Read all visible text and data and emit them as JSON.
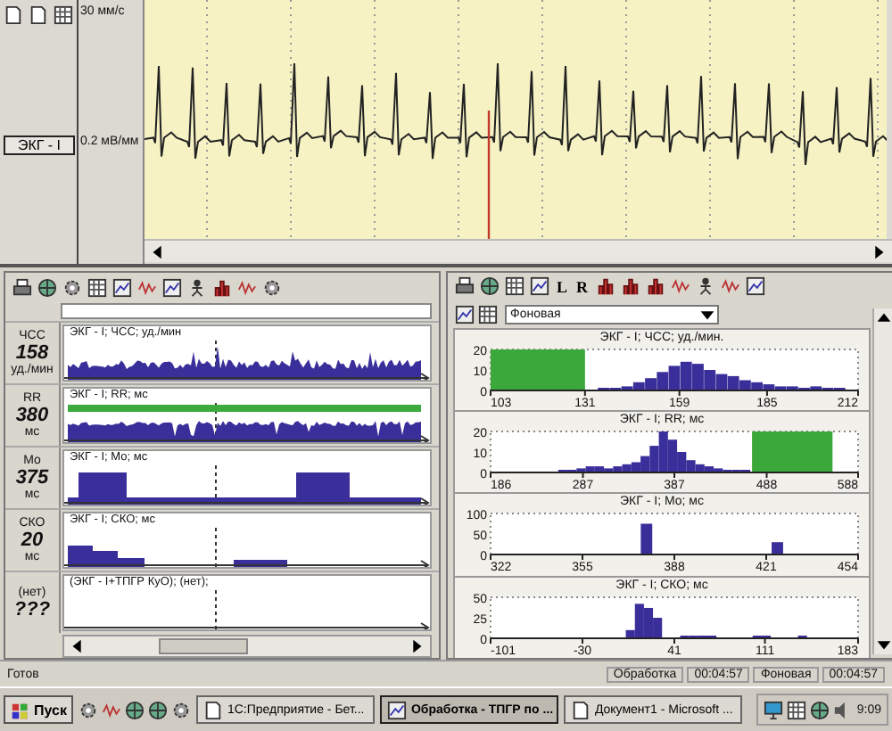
{
  "ecg": {
    "speed": "30 мм/с",
    "gain": "0.2 мВ/мм",
    "lead": "ЭКГ - I"
  },
  "trend_panel": {
    "rows": [
      {
        "name": "ЧСС",
        "value": "158",
        "unit": "уд./мин",
        "title": "ЭКГ - I; ЧСС; уд./мин",
        "kind": "dense"
      },
      {
        "name": "RR",
        "value": "380",
        "unit": "мс",
        "title": "ЭКГ - I; RR; мс",
        "kind": "dense-band"
      },
      {
        "name": "Мо",
        "value": "375",
        "unit": "мс",
        "title": "ЭКГ - I; Мо; мс",
        "kind": "blocks"
      },
      {
        "name": "СКО",
        "value": "20",
        "unit": "мс",
        "title": "ЭКГ - I; СКО; мс",
        "kind": "decay"
      },
      {
        "name": "(нет)",
        "value": "???",
        "title": "(ЭКГ - I+ТПГР КуО); (нет);",
        "kind": "empty"
      }
    ]
  },
  "histogram_panel": {
    "toolbar_letters": [
      "L",
      "R"
    ],
    "mode": "Фоновая",
    "charts": [
      {
        "chart_data": {
          "type": "bar",
          "title": "ЭКГ - I; ЧСС; уд./мин.",
          "x": [
            136.5,
            140,
            143.5,
            147,
            150.5,
            154,
            157.5,
            161,
            164.5,
            168,
            171.5,
            175,
            178.5,
            182,
            185.5,
            189,
            192.5,
            196,
            199.5,
            203,
            206.5
          ],
          "series": [
            {
              "color": "#3a2f9a",
              "values": [
                1,
                1,
                2,
                4,
                6,
                9,
                12,
                14,
                13,
                10,
                8,
                7,
                5,
                4,
                3,
                2,
                2,
                1,
                2,
                1,
                1
              ]
            }
          ],
          "xlim": [
            103,
            212
          ],
          "ylim": [
            0,
            20
          ],
          "xticks": [
            103,
            131,
            159,
            185,
            212
          ],
          "yticks": [
            0,
            10,
            20
          ],
          "bands": [
            {
              "axis": "x",
              "from": 103,
              "to": 131,
              "color": "#3aa83a"
            }
          ]
        }
      },
      {
        "chart_data": {
          "type": "bar",
          "title": "ЭКГ - I; RR; мс",
          "x": [
            265,
            275,
            285,
            295,
            305,
            315,
            325,
            335,
            345,
            355,
            365,
            375,
            385,
            395,
            405,
            415,
            425,
            435,
            445,
            455,
            465
          ],
          "series": [
            {
              "color": "#3a2f9a",
              "values": [
                1,
                1,
                2,
                3,
                3,
                2,
                3,
                4,
                5,
                8,
                13,
                20,
                16,
                10,
                6,
                4,
                3,
                2,
                1,
                1,
                1
              ]
            }
          ],
          "xlim": [
            186,
            588
          ],
          "ylim": [
            0,
            20
          ],
          "xticks": [
            186,
            287,
            387,
            488,
            588
          ],
          "yticks": [
            0,
            10,
            20
          ],
          "bands": [
            {
              "axis": "x",
              "from": 472,
              "to": 560,
              "color": "#3aa83a"
            }
          ]
        }
      },
      {
        "chart_data": {
          "type": "bar",
          "title": "ЭКГ - I; Мо; мс",
          "x": [
            378,
            425
          ],
          "series": [
            {
              "color": "#3a2f9a",
              "values": [
                75,
                30
              ]
            }
          ],
          "xlim": [
            322,
            454
          ],
          "ylim": [
            0,
            100
          ],
          "xticks": [
            322,
            355,
            388,
            421,
            454
          ],
          "yticks": [
            0,
            50,
            100
          ]
        }
      },
      {
        "chart_data": {
          "type": "bar",
          "title": "ЭКГ - I; СКО; мс",
          "x": [
            7,
            14,
            21,
            28,
            49,
            56,
            63,
            70,
            105,
            112,
            140
          ],
          "series": [
            {
              "color": "#3a2f9a",
              "values": [
                10,
                42,
                37,
                25,
                2,
                2,
                2,
                1,
                3,
                2,
                1
              ]
            }
          ],
          "xlim": [
            -101,
            183
          ],
          "ylim": [
            0,
            50
          ],
          "xticks": [
            -101,
            -30,
            41,
            111,
            183
          ],
          "yticks": [
            0,
            25,
            50
          ]
        }
      }
    ]
  },
  "status_bar": {
    "text": "Готов",
    "fields": [
      "Обработка",
      "00:04:57",
      "Фоновая",
      "00:04:57"
    ]
  },
  "taskbar": {
    "start": "Пуск",
    "tasks": [
      {
        "label": "1С:Предприятие - Бет...",
        "selected": false
      },
      {
        "label": "Обработка - ТПГР по ...",
        "selected": true
      },
      {
        "label": "Документ1 - Microsoft ...",
        "selected": false
      }
    ],
    "clock": "9:09"
  }
}
